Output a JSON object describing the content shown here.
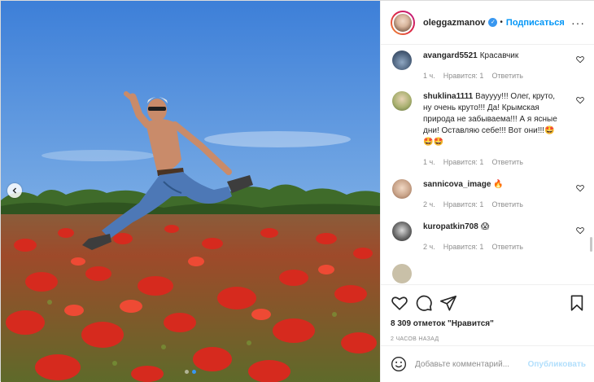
{
  "post": {
    "username": "oleggazmanov",
    "verified_mark": "✓",
    "separator": "•",
    "follow_label": "Подписаться",
    "more_label": "···",
    "likes_text": "8 309 отметок \"Нравится\"",
    "time_text": "2 часов назад"
  },
  "comments": [
    {
      "user": "avangard5521",
      "text": "Красавчик",
      "time": "",
      "likes": "",
      "reply": "",
      "avatar_color": "#4a5f7a"
    },
    {
      "user": "shuklina1111",
      "text": "Вауууу!!! Олег, круто, ну очень круто!!! Да! Крымская природа не забываема!!! А я ясные дни! Оставляю себе!!! Вот они!!!🤩🤩🤩",
      "time": "1 ч.",
      "likes": "Нравится: 1",
      "reply": "Ответить",
      "avatar_color": "#8a9b5e"
    },
    {
      "user": "sannicova_image",
      "text": "🔥",
      "time": "2 ч.",
      "likes": "Нравится: 1",
      "reply": "Ответить",
      "avatar_color": "#c9a48a"
    },
    {
      "user": "kuropatkin708",
      "text": "😱",
      "time": "2 ч.",
      "likes": "Нравится: 1",
      "reply": "Ответить",
      "avatar_color": "#3a3a3a"
    }
  ],
  "first_meta": {
    "time": "1 ч.",
    "likes": "Нравится: 1",
    "reply": "Ответить"
  },
  "composer": {
    "placeholder": "Добавьте комментарий...",
    "publish_label": "Опубликовать"
  },
  "icons": {
    "like": "heart-icon",
    "comment": "comment-icon",
    "share": "share-icon",
    "save": "bookmark-icon",
    "emoji": "emoji-icon",
    "prev": "chevron-left-icon"
  },
  "colors": {
    "accent": "#0095f6",
    "verified": "#3897f0",
    "muted": "#8e8e8e",
    "publish_disabled": "#b2dffc"
  }
}
